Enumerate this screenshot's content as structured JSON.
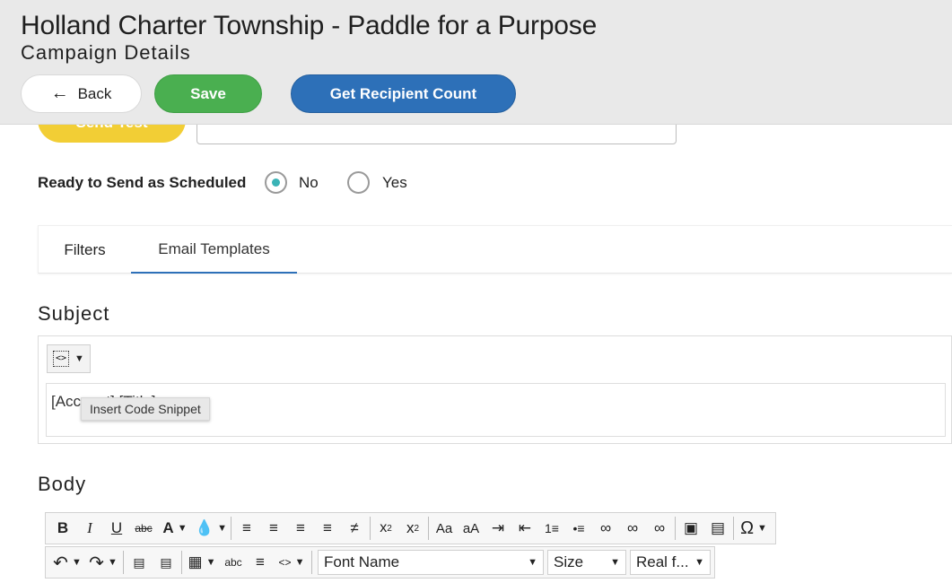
{
  "header": {
    "title": "Holland Charter Township - Paddle for a Purpose",
    "subtitle": "Campaign Details",
    "back_label": "Back",
    "save_label": "Save",
    "recipient_count_label": "Get Recipient Count"
  },
  "send_test": {
    "button_label": "Send Test"
  },
  "ready": {
    "label": "Ready to Send as Scheduled",
    "options": [
      {
        "label": "No",
        "selected": true
      },
      {
        "label": "Yes",
        "selected": false
      }
    ]
  },
  "tabs": [
    {
      "label": "Filters",
      "active": false
    },
    {
      "label": "Email Templates",
      "active": true
    }
  ],
  "subject": {
    "title": "Subject",
    "value": "[Account] [Title]",
    "tooltip": "Insert Code Snippet"
  },
  "body": {
    "title": "Body",
    "font_name": "Font Name",
    "font_size": "Size",
    "format": "Real f..."
  },
  "colors": {
    "save": "#4aaf50",
    "primary": "#2d70b8",
    "send_test": "#f2ce35",
    "radio_selected": "#3ab3b6"
  },
  "icons": {
    "toolbar_row1": [
      "bold",
      "italic",
      "underline",
      "strikethrough",
      "font-color",
      "bg-color",
      "align-left",
      "align-center",
      "align-right",
      "justify",
      "clear-format",
      "superscript",
      "subscript",
      "uppercase",
      "lowercase",
      "indent",
      "outdent",
      "ordered-list",
      "unordered-list",
      "link",
      "unlink",
      "anchor",
      "image",
      "template",
      "special-char"
    ],
    "toolbar_row2": [
      "undo",
      "redo",
      "paste-word",
      "paste-text",
      "table",
      "spellcheck",
      "paragraph",
      "code-snippet"
    ]
  }
}
